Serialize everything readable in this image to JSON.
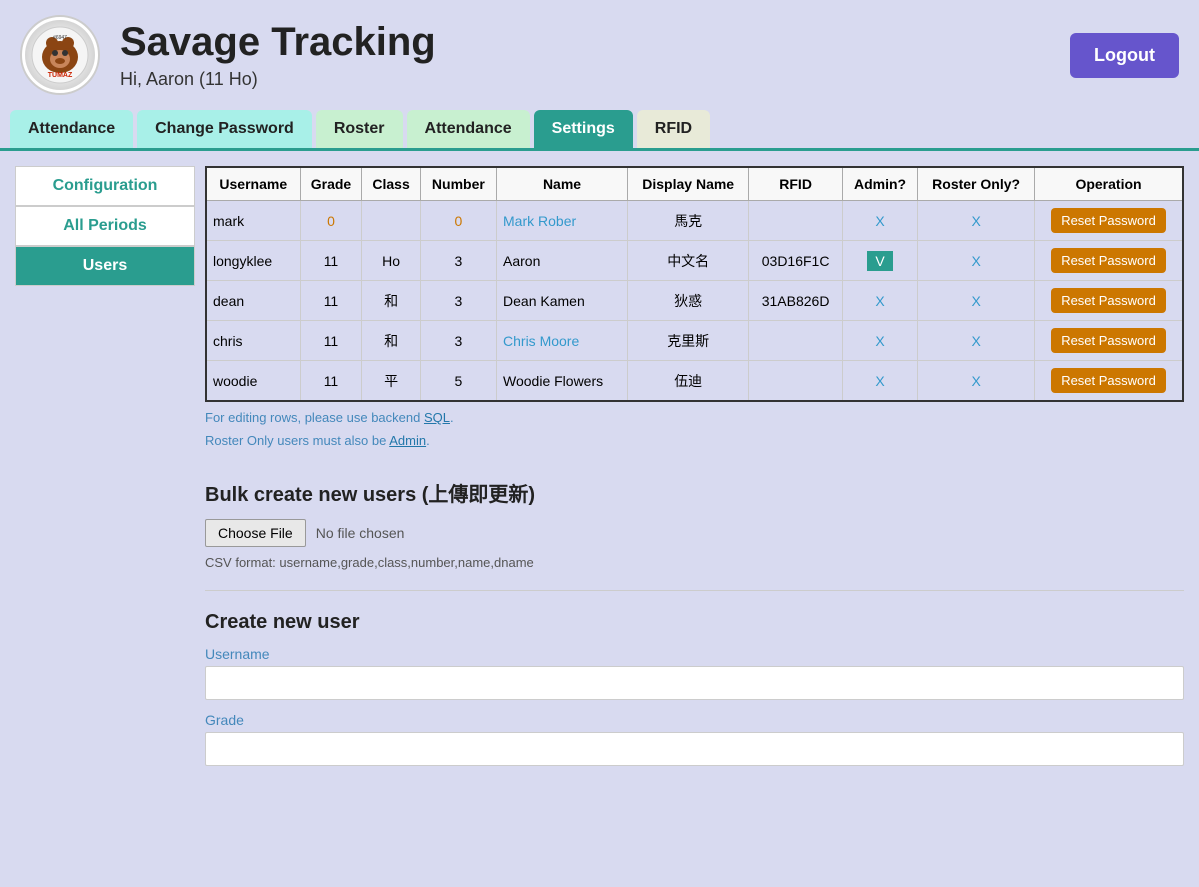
{
  "header": {
    "app_title": "Savage Tracking",
    "subtitle": "Hi, Aaron (11 Ho)",
    "logout_label": "Logout",
    "logo_text": "TUMAZ"
  },
  "nav": {
    "tabs": [
      {
        "label": "Attendance",
        "style": "cyan"
      },
      {
        "label": "Change Password",
        "style": "cyan"
      },
      {
        "label": "Roster",
        "style": "light-green"
      },
      {
        "label": "Attendance",
        "style": "light-green"
      },
      {
        "label": "Settings",
        "style": "active"
      },
      {
        "label": "RFID",
        "style": "light-gray"
      }
    ]
  },
  "sidebar": {
    "items": [
      {
        "label": "Configuration",
        "style": "active-green"
      },
      {
        "label": "All Periods",
        "style": "active-green"
      },
      {
        "label": "Users",
        "style": "active-dark"
      }
    ]
  },
  "table": {
    "columns": [
      "Username",
      "Grade",
      "Class",
      "Number",
      "Name",
      "Display Name",
      "RFID",
      "Admin?",
      "Roster Only?",
      "Operation"
    ],
    "rows": [
      {
        "username": "mark",
        "grade": "0",
        "class": "",
        "number": "0",
        "name": "Mark Rober",
        "display_name": "馬克",
        "rfid": "",
        "admin": "X",
        "roster_only": "X",
        "op": "Reset Password",
        "name_color": "blue"
      },
      {
        "username": "longyklee",
        "grade": "11",
        "class": "Ho",
        "number": "3",
        "name": "Aaron",
        "display_name": "中文名",
        "rfid": "03D16F1C",
        "admin": "V",
        "roster_only": "X",
        "op": "Reset Password",
        "name_color": "normal",
        "admin_highlight": true
      },
      {
        "username": "dean",
        "grade": "11",
        "class": "和",
        "number": "3",
        "name": "Dean Kamen",
        "display_name": "狄惑",
        "rfid": "31AB826D",
        "admin": "X",
        "roster_only": "X",
        "op": "Reset Password",
        "name_color": "normal"
      },
      {
        "username": "chris",
        "grade": "11",
        "class": "和",
        "number": "3",
        "name": "Chris Moore",
        "display_name": "克里斯",
        "rfid": "",
        "admin": "X",
        "roster_only": "X",
        "op": "Reset Password",
        "name_color": "blue"
      },
      {
        "username": "woodie",
        "grade": "11",
        "class": "平",
        "number": "5",
        "name": "Woodie Flowers",
        "display_name": "伍迪",
        "rfid": "",
        "admin": "X",
        "roster_only": "X",
        "op": "Reset Password",
        "name_color": "normal"
      }
    ]
  },
  "info": {
    "line1": "For editing rows, please use backend SQL.",
    "line2": "Roster Only users must also be Admin."
  },
  "bulk_section": {
    "title": "Bulk create new users (上傳即更新)",
    "choose_file_label": "Choose File",
    "no_file_text": "No file chosen",
    "csv_format": "CSV format: username,grade,class,number,name,dname"
  },
  "create_section": {
    "title": "Create new user",
    "username_label": "Username",
    "grade_label": "Grade"
  }
}
